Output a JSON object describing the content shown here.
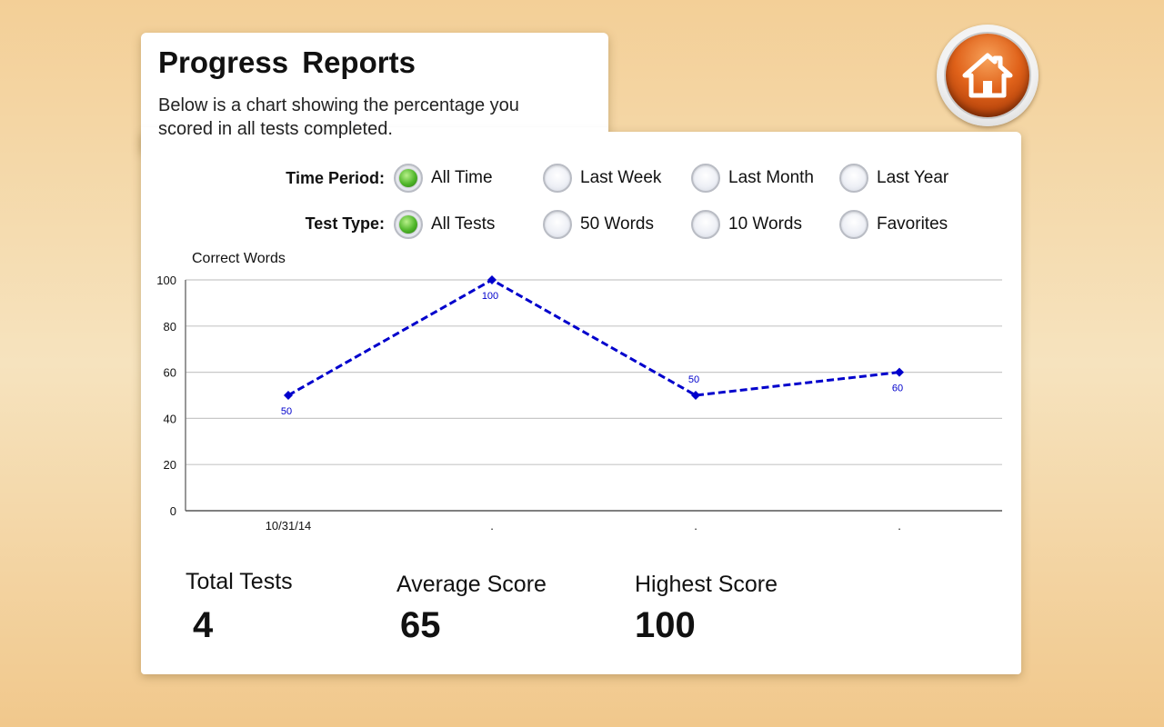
{
  "header": {
    "title": "Progress Reports",
    "description": "Below is a chart showing the percentage you scored in all tests completed."
  },
  "filters": {
    "time_period": {
      "label": "Time Period:",
      "options": [
        "All Time",
        "Last Week",
        "Last Month",
        "Last Year"
      ],
      "selected": "All Time"
    },
    "test_type": {
      "label": "Test Type:",
      "options": [
        "All Tests",
        "50 Words",
        "10 Words",
        "Favorites"
      ],
      "selected": "All Tests"
    }
  },
  "chart_data": {
    "type": "line",
    "ylabel": "Correct Words",
    "categories": [
      "10/31/14",
      ".",
      ".",
      "."
    ],
    "series": [
      {
        "values": [
          50,
          100,
          50,
          60
        ],
        "color": "#0000cc"
      }
    ],
    "data_labels": [
      "50",
      "100",
      "50",
      "60"
    ],
    "yticks": [
      0,
      20,
      40,
      60,
      80,
      100
    ],
    "ylim": [
      0,
      100
    ],
    "grid": true
  },
  "stats": {
    "total_tests_label": "Total Tests",
    "total_tests_value": "4",
    "average_score_label": "Average Score",
    "average_score_value": "65",
    "highest_score_label": "Highest Score",
    "highest_score_value": "100"
  },
  "icons": {
    "home": "home-icon"
  },
  "colors": {
    "accent_orange": "#e0621a",
    "selected_green": "#4fb62a",
    "series_blue": "#0000cc"
  }
}
